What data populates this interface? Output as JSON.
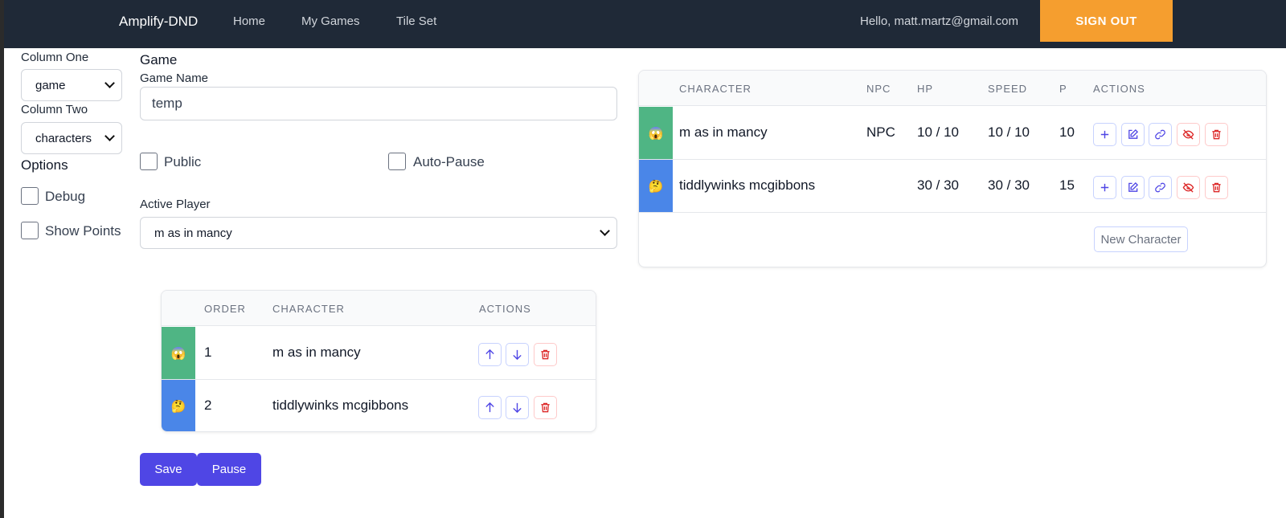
{
  "nav": {
    "brand": "Amplify-DND",
    "links": [
      "Home",
      "My Games",
      "Tile Set"
    ],
    "greeting": "Hello, matt.martz@gmail.com",
    "signout_label": "Sign Out"
  },
  "options_panel": {
    "column_one_label": "Column One",
    "column_one_value": "game",
    "column_two_label": "Column Two",
    "column_two_value": "characters",
    "options_heading": "Options",
    "debug_label": "Debug",
    "debug_checked": false,
    "show_points_label": "Show Points",
    "show_points_checked": false
  },
  "game_form": {
    "heading": "Game",
    "name_label": "Game Name",
    "name_value": "temp",
    "public_label": "Public",
    "public_checked": false,
    "auto_pause_label": "Auto-Pause",
    "auto_pause_checked": false,
    "active_player_label": "Active Player",
    "active_player_value": "m as in mancy"
  },
  "order_table": {
    "headers": [
      "Order",
      "Character",
      "Actions"
    ],
    "rows": [
      {
        "emoji": "😱",
        "color": "#4fb584",
        "order": "1",
        "character": "m as in mancy"
      },
      {
        "emoji": "🤔",
        "color": "#4a86e8",
        "order": "2",
        "character": "tiddlywinks mcgibbons"
      }
    ]
  },
  "character_table": {
    "headers": [
      "Character",
      "NPC",
      "HP",
      "Speed",
      "P",
      "Actions"
    ],
    "rows": [
      {
        "emoji": "😱",
        "color": "#4fb584",
        "character": "m as in mancy",
        "npc": "NPC",
        "hp": "10 / 10",
        "speed": "10 / 10",
        "p": "10"
      },
      {
        "emoji": "🤔",
        "color": "#4a86e8",
        "character": "tiddlywinks mcgibbons",
        "npc": "",
        "hp": "30 / 30",
        "speed": "30 / 30",
        "p": "15"
      }
    ],
    "new_character_label": "New Character"
  },
  "buttons": {
    "save_label": "Save",
    "pause_label": "Pause"
  },
  "colors": {
    "navbar": "#1f2937",
    "signout": "#f59e2f",
    "primary": "#4f46e5",
    "danger": "#dc2626"
  },
  "icons": [
    "plus-icon",
    "edit-icon",
    "link-icon",
    "eye-off-icon",
    "trash-icon",
    "arrow-up-icon",
    "arrow-down-icon",
    "chevron-down-icon"
  ]
}
